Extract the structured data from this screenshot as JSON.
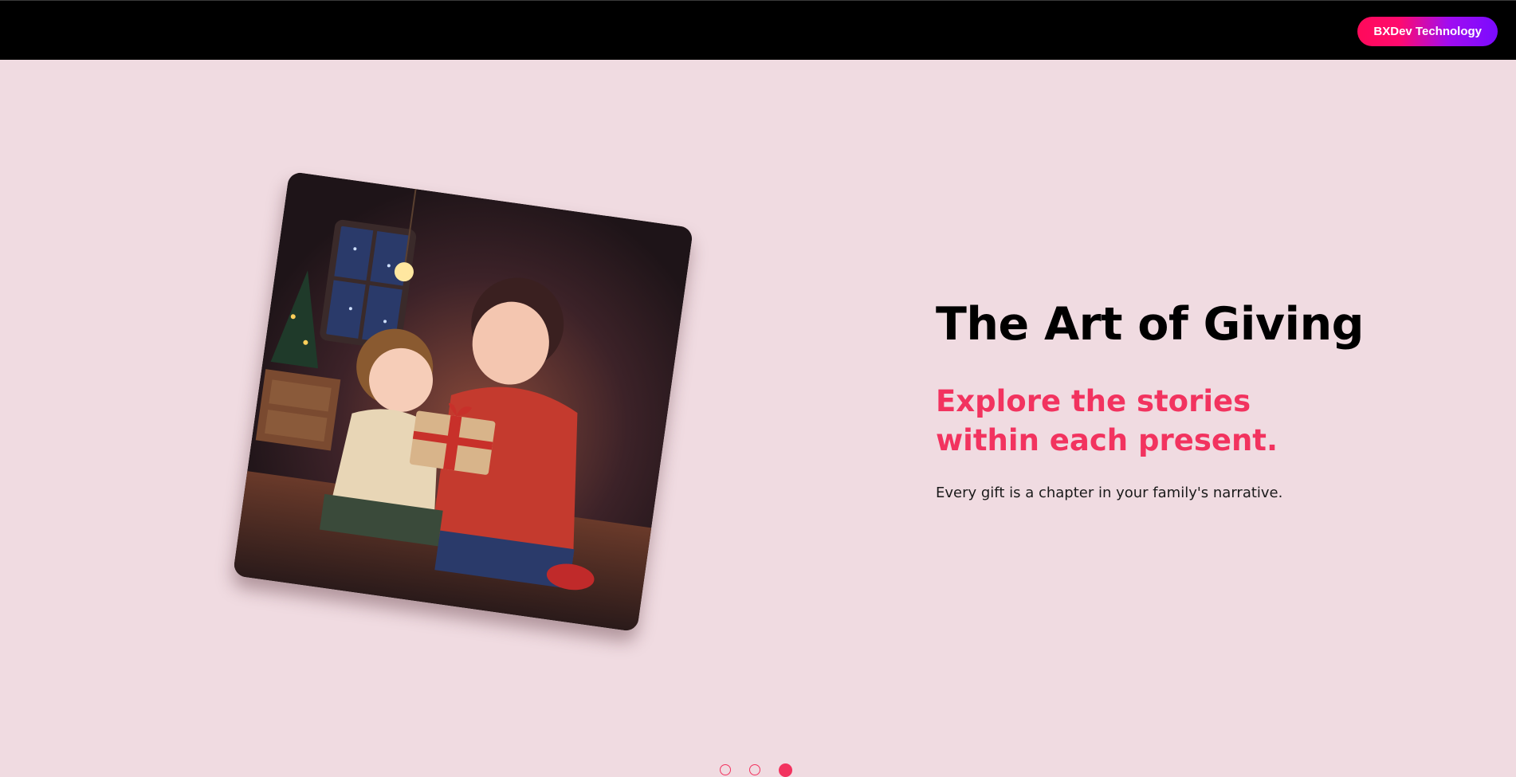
{
  "header": {
    "brand_button_label": "BXDev Technology"
  },
  "slide": {
    "title": "The Art of Giving",
    "subtitle": "Explore the stories within each present.",
    "body": "Every gift is a chapter in your family's narrative.",
    "image_subject": "illustration-mother-and-child-with-gift"
  },
  "carousel": {
    "dots": [
      {
        "active": false
      },
      {
        "active": false
      },
      {
        "active": true
      }
    ],
    "active_index": 2
  },
  "colors": {
    "page_background": "#f0dbe1",
    "topbar": "#000000",
    "accent": "#f2335f",
    "brand_gradient_start": "#ff0a5a",
    "brand_gradient_end": "#7a0bff"
  }
}
